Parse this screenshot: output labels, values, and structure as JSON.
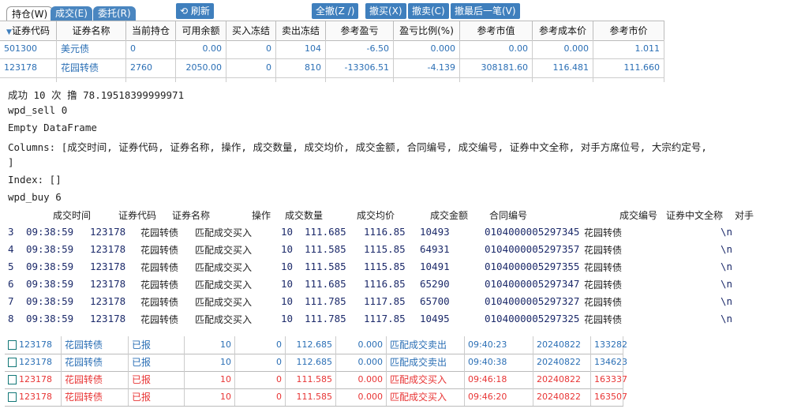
{
  "tabs": [
    "持仓(W)",
    "成交(E)",
    "委托(R)"
  ],
  "buttons": {
    "refresh": "刷新",
    "cancel_all": "全撤(Z /)",
    "cancel_buy": "撤买(X)",
    "cancel_sell": "撤卖(C)",
    "cancel_last": "撤最后一笔(V)"
  },
  "holdings": {
    "columns": [
      "证券代码",
      "证券名称",
      "当前持仓",
      "可用余额",
      "买入冻结",
      "卖出冻结",
      "参考盈亏",
      "盈亏比例(%)",
      "参考市值",
      "参考成本价",
      "参考市价"
    ],
    "rows": [
      [
        "501300",
        "美元债",
        "0",
        "0.00",
        "0",
        "104",
        "-6.50",
        "0.000",
        "0.00",
        "0.000",
        "1.011"
      ],
      [
        "123178",
        "花园转债",
        "2760",
        "2050.00",
        "0",
        "810",
        "-13306.51",
        "-4.139",
        "308181.60",
        "116.481",
        "111.660"
      ]
    ]
  },
  "console": {
    "lines": [
      "成功 10 次 撸 78.19518399999971",
      "wpd_sell 0",
      "Empty DataFrame",
      "Columns: [成交时间, 证券代码, 证券名称, 操作, 成交数量, 成交均价, 成交金额, 合同编号, 成交编号, 证券中文全称, 对手方席位号, 大宗约定号,",
      "]",
      "Index: []",
      "wpd_buy 6"
    ],
    "table_headers": [
      "成交时间",
      "证券代码",
      "证券名称",
      "操作",
      "成交数量",
      "成交均价",
      "成交金额",
      "合同编号",
      "成交编号",
      "证券中文全称",
      "对手"
    ],
    "rows": [
      [
        "3",
        "09:38:59",
        "123178",
        "花园转债",
        "匹配成交买入",
        "10",
        "111.685",
        "1116.85",
        "10493",
        "0104000005297345",
        "花园转债",
        "\\n"
      ],
      [
        "4",
        "09:38:59",
        "123178",
        "花园转债",
        "匹配成交买入",
        "10",
        "111.585",
        "1115.85",
        "64931",
        "0104000005297357",
        "花园转债",
        "\\n"
      ],
      [
        "5",
        "09:38:59",
        "123178",
        "花园转债",
        "匹配成交买入",
        "10",
        "111.585",
        "1115.85",
        "10491",
        "0104000005297355",
        "花园转债",
        "\\n"
      ],
      [
        "6",
        "09:38:59",
        "123178",
        "花园转债",
        "匹配成交买入",
        "10",
        "111.685",
        "1116.85",
        "65290",
        "0104000005297347",
        "花园转债",
        "\\n"
      ],
      [
        "7",
        "09:38:59",
        "123178",
        "花园转债",
        "匹配成交买入",
        "10",
        "111.785",
        "1117.85",
        "65700",
        "0104000005297327",
        "花园转债",
        "\\n"
      ],
      [
        "8",
        "09:38:59",
        "123178",
        "花园转债",
        "匹配成交买入",
        "10",
        "111.785",
        "1117.85",
        "10495",
        "0104000005297325",
        "花园转债",
        "\\n"
      ]
    ]
  },
  "orders": {
    "rows": [
      [
        "123178",
        "花园转债",
        "已报",
        "10",
        "0",
        "112.685",
        "0.000",
        "匹配成交卖出",
        "09:40:23",
        "20240822",
        "133282"
      ],
      [
        "123178",
        "花园转债",
        "已报",
        "10",
        "0",
        "112.685",
        "0.000",
        "匹配成交卖出",
        "09:40:38",
        "20240822",
        "134623"
      ],
      [
        "123178",
        "花园转债",
        "已报",
        "10",
        "0",
        "111.585",
        "0.000",
        "匹配成交买入",
        "09:46:18",
        "20240822",
        "163337"
      ],
      [
        "123178",
        "花园转债",
        "已报",
        "10",
        "0",
        "111.585",
        "0.000",
        "匹配成交买入",
        "09:46:20",
        "20240822",
        "163507"
      ]
    ]
  },
  "colors": {
    "sell": "#2b6fb5",
    "buy": "#e83535",
    "accent": "#3f7fbd"
  }
}
